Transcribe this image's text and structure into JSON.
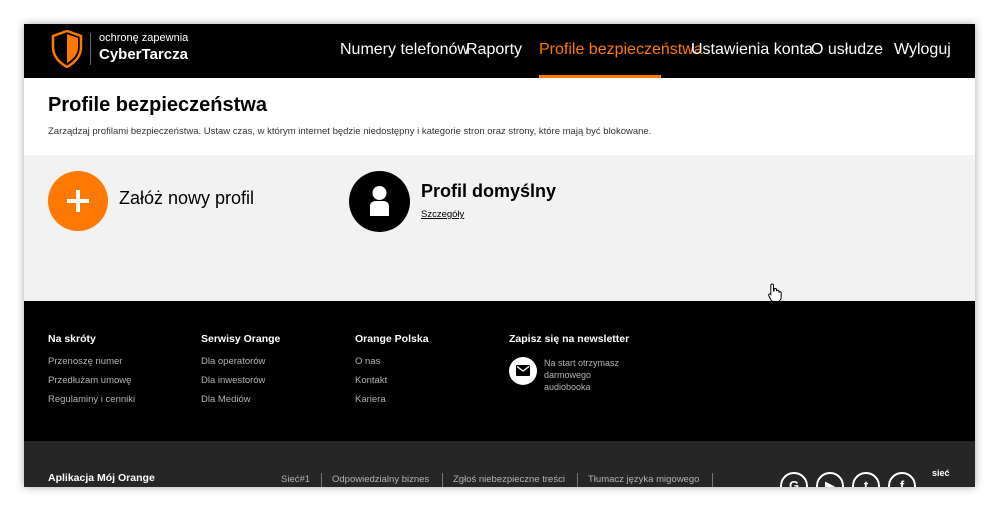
{
  "header": {
    "logo_line1": "ochronę zapewnia",
    "logo_line2": "CyberTarcza",
    "nav": [
      {
        "label": "Numery telefonów"
      },
      {
        "label": "Raporty"
      },
      {
        "label": "Profile bezpieczeństwa",
        "active": true
      },
      {
        "label": "Ustawienia konta"
      },
      {
        "label": "O usłudze"
      },
      {
        "label": "Wyloguj"
      }
    ]
  },
  "page": {
    "title": "Profile bezpieczeństwa",
    "description": "Zarządzaj profilami bezpieczeństwa. Ustaw czas, w którym internet będzie niedostępny i kategorie stron oraz strony, które mają być blokowane."
  },
  "profiles": {
    "add_label": "Załóż nowy profil",
    "default_profile": {
      "name": "Profil domyślny",
      "details_link": "Szczegóły"
    }
  },
  "footer": {
    "columns": [
      {
        "title": "Na skróty",
        "links": [
          "Przenoszę numer",
          "Przedłużam umowę",
          "Regulaminy i cenniki"
        ]
      },
      {
        "title": "Serwisy Orange",
        "links": [
          "Dla operatorów",
          "Dla inwestorów",
          "Dla Mediów"
        ]
      },
      {
        "title": "Orange Polska",
        "links": [
          "O nas",
          "Kontakt",
          "Kariera"
        ]
      }
    ],
    "newsletter": {
      "title": "Zapisz się na newsletter",
      "text": "Na start otrzymasz darmowego audiobooka"
    }
  },
  "bottom": {
    "app_label": "Aplikacja Mój Orange",
    "links": [
      "Sieć#1",
      "Odpowiedzialny biznes",
      "Zgłoś niebezpieczne treści",
      "Tłumacz języka migowego"
    ],
    "social": [
      "google-icon",
      "youtube-icon",
      "twitter-icon",
      "facebook-icon"
    ],
    "badge_text": "sieć"
  },
  "colors": {
    "accent": "#ff7900",
    "header_bg": "#000000",
    "profiles_bg": "#f2f2f2",
    "bottom_bg": "#262626"
  }
}
